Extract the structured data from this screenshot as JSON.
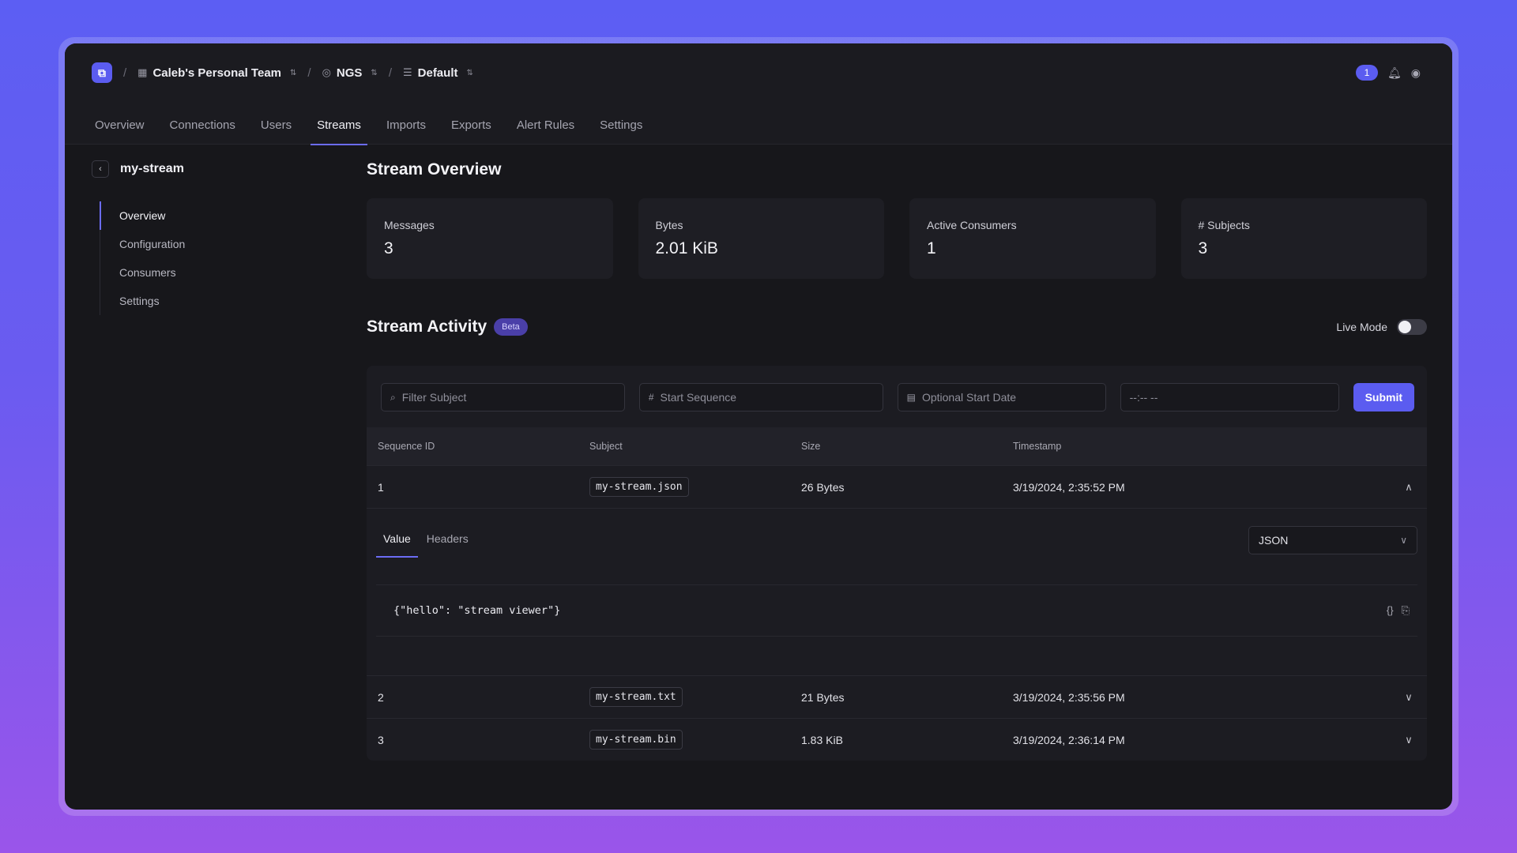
{
  "breadcrumb": {
    "team": "Caleb's Personal Team",
    "system": "NGS",
    "account": "Default"
  },
  "header": {
    "notification_count": "1"
  },
  "tabs": [
    {
      "label": "Overview"
    },
    {
      "label": "Connections"
    },
    {
      "label": "Users"
    },
    {
      "label": "Streams"
    },
    {
      "label": "Imports"
    },
    {
      "label": "Exports"
    },
    {
      "label": "Alert Rules"
    },
    {
      "label": "Settings"
    }
  ],
  "sidebar": {
    "stream_name": "my-stream",
    "items": [
      {
        "label": "Overview"
      },
      {
        "label": "Configuration"
      },
      {
        "label": "Consumers"
      },
      {
        "label": "Settings"
      }
    ]
  },
  "overview": {
    "title": "Stream Overview",
    "stats": [
      {
        "label": "Messages",
        "value": "3"
      },
      {
        "label": "Bytes",
        "value": "2.01 KiB"
      },
      {
        "label": "Active Consumers",
        "value": "1"
      },
      {
        "label": "# Subjects",
        "value": "3"
      }
    ]
  },
  "activity": {
    "title": "Stream Activity",
    "badge": "Beta",
    "live_mode_label": "Live Mode",
    "live_mode_on": false,
    "filters": {
      "subject_placeholder": "Filter Subject",
      "sequence_placeholder": "Start Sequence",
      "date_placeholder": "Optional Start Date",
      "time_placeholder": "--:-- --",
      "submit_label": "Submit"
    },
    "columns": [
      "Sequence ID",
      "Subject",
      "Size",
      "Timestamp"
    ],
    "rows": [
      {
        "seq": "1",
        "subject": "my-stream.json",
        "size": "26 Bytes",
        "timestamp": "3/19/2024, 2:35:52 PM"
      },
      {
        "seq": "2",
        "subject": "my-stream.txt",
        "size": "21 Bytes",
        "timestamp": "3/19/2024, 2:35:56 PM"
      },
      {
        "seq": "3",
        "subject": "my-stream.bin",
        "size": "1.83 KiB",
        "timestamp": "3/19/2024, 2:36:14 PM"
      }
    ],
    "expanded": {
      "tabs": [
        "Value",
        "Headers"
      ],
      "format": "JSON",
      "value": "{\"hello\": \"stream viewer\"}"
    }
  },
  "colors": {
    "accent": "#5b5cf0",
    "background": "#17171b"
  }
}
